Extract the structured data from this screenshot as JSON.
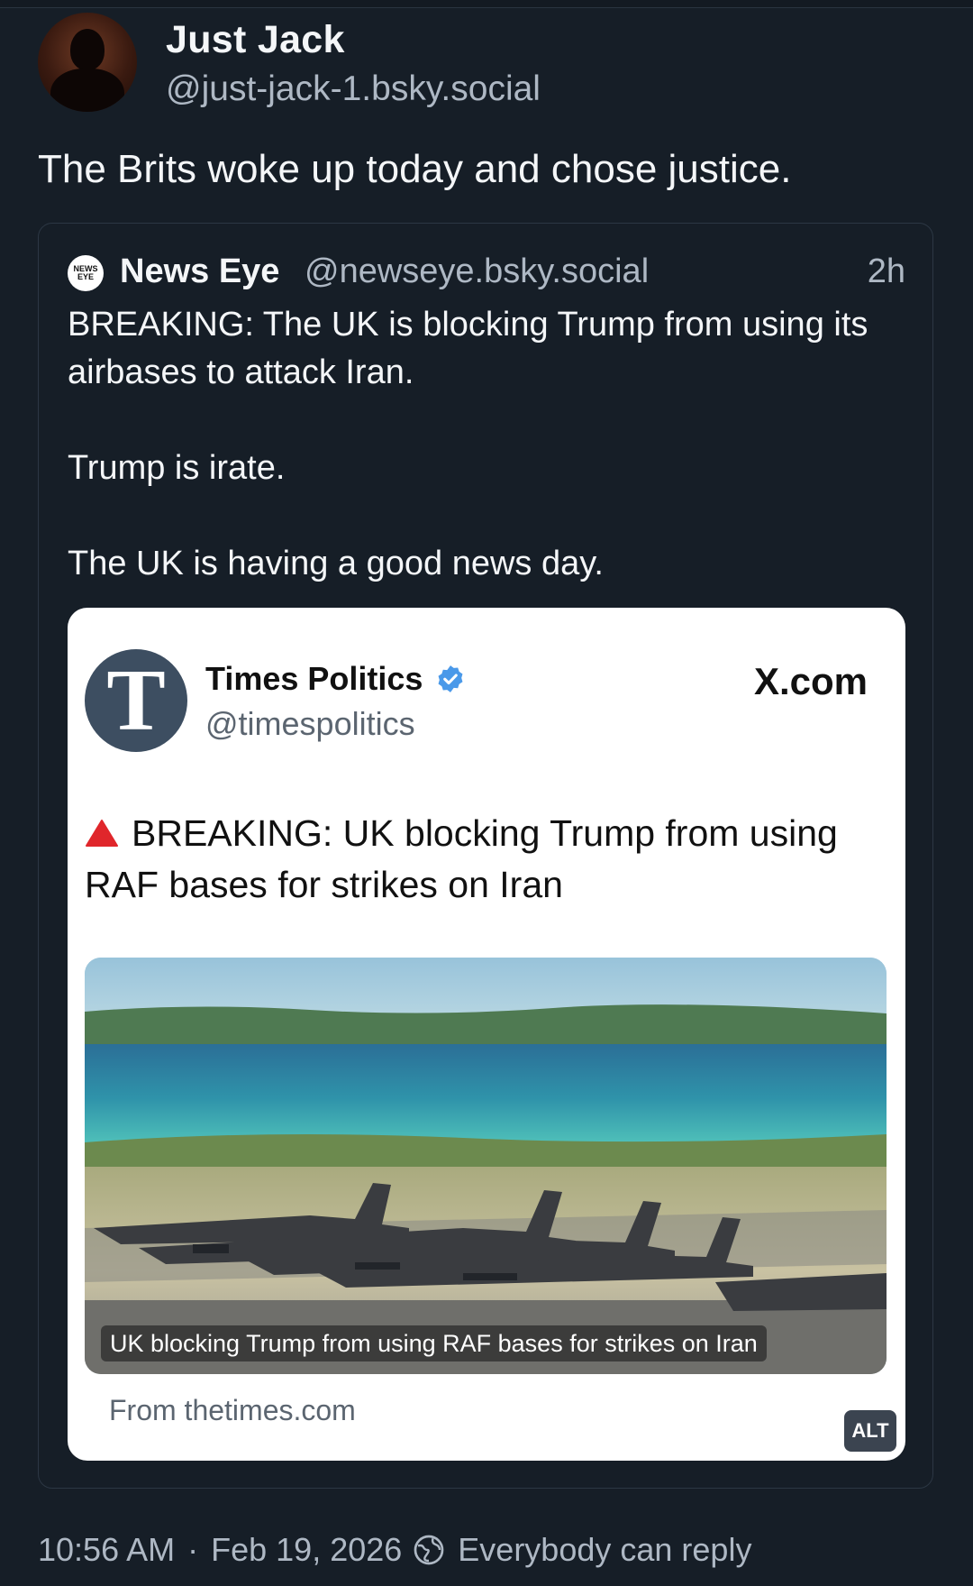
{
  "post": {
    "author_name": "Just Jack",
    "author_handle": "@just-jack-1.bsky.social",
    "text": "The Brits woke up today and chose justice.",
    "time": "10:56 AM",
    "separator": "·",
    "date": "Feb 19, 2026",
    "reply_setting": "Everybody can reply"
  },
  "quote": {
    "logo_text_top": "NEWS",
    "logo_text_bottom": "EYE",
    "author_name": "News Eye",
    "author_handle": "@newseye.bsky.social",
    "age": "2h",
    "paragraphs": [
      "BREAKING: The UK is blocking Trump from using its airbases to attack Iran.",
      "Trump is irate.",
      "The UK is having a good news day."
    ]
  },
  "embed": {
    "logo_letter": "T",
    "account_name": "Times Politics",
    "account_handle": "@timespolitics",
    "site_badge": "X.com",
    "headline": "BREAKING: UK blocking Trump from using RAF bases for strikes on Iran",
    "image_caption": "UK blocking Trump from using RAF bases for strikes on Iran",
    "source": "From thetimes.com",
    "alt_label": "ALT"
  },
  "colors": {
    "background": "#161e27",
    "muted_text": "#aeb8c4",
    "verified_blue": "#4a99e9",
    "warning_red": "#e0262b",
    "times_logo_bg": "#3d4e61"
  }
}
